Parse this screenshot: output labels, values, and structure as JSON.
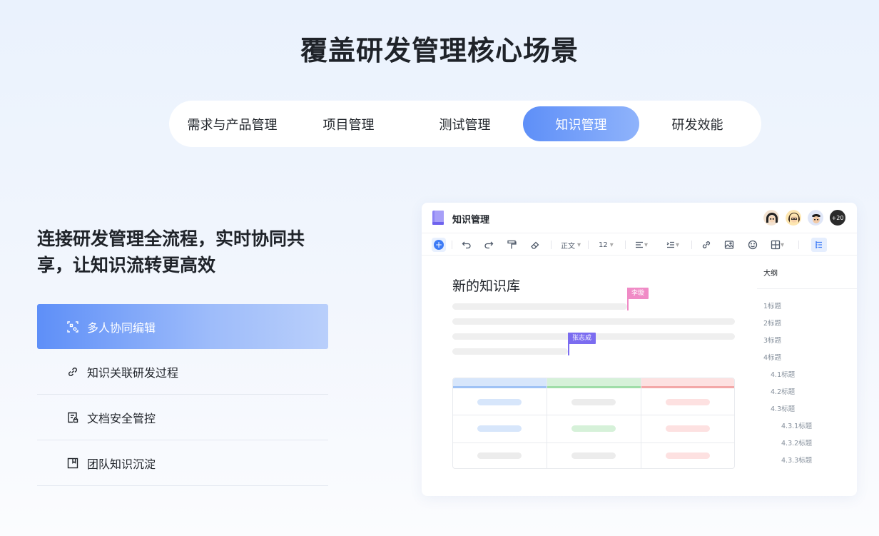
{
  "page": {
    "title": "覆盖研发管理核心场景"
  },
  "tabs": [
    {
      "label": "需求与产品管理",
      "active": false
    },
    {
      "label": "项目管理",
      "active": false
    },
    {
      "label": "测试管理",
      "active": false
    },
    {
      "label": "知识管理",
      "active": true
    },
    {
      "label": "研发效能",
      "active": false
    }
  ],
  "section": {
    "headline": "连接研发管理全流程，实时协同共享，让知识流转更高效",
    "features": [
      {
        "label": "多人协同编辑",
        "icon": "collaboration-icon",
        "active": true
      },
      {
        "label": "知识关联研发过程",
        "icon": "link-icon",
        "active": false
      },
      {
        "label": "文档安全管控",
        "icon": "document-lock-icon",
        "active": false
      },
      {
        "label": "团队知识沉淀",
        "icon": "bookmark-icon",
        "active": false
      }
    ]
  },
  "editor": {
    "title": "知识管理",
    "avatar_more": "+20",
    "toolbar": {
      "style_label": "正文",
      "size_label": "12"
    },
    "doc_title": "新的知识库",
    "cursors": [
      {
        "name": "李璇",
        "color": "#f08bc6"
      },
      {
        "name": "张志成",
        "color": "#7b6cf0"
      }
    ],
    "table_colors": {
      "col1": "#d7e6fb",
      "col2": "#d6f1d9",
      "col3": "#fde1e1",
      "line1": "#9fc2f5",
      "line2": "#9fdda8",
      "line3": "#f3a7a7"
    },
    "outline": {
      "title": "大纲",
      "items": [
        "1标题",
        "2标题",
        "3标题",
        "4标题",
        "4.1标题",
        "4.2标题",
        "4.3标题",
        "4.3.1标题",
        "4.3.2标题",
        "4.3.3标题"
      ]
    }
  },
  "colors": {
    "accent": "#5e8ff8",
    "accent_light": "#b9cffb"
  }
}
